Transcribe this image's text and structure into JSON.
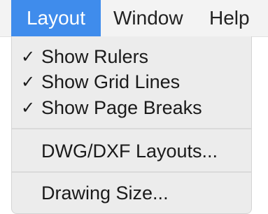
{
  "menubar": {
    "items": [
      {
        "label": "Layout",
        "active": true
      },
      {
        "label": "Window",
        "active": false
      },
      {
        "label": "Help",
        "active": false
      }
    ],
    "accent_color": "#3f8cec"
  },
  "dropdown": {
    "items": [
      {
        "label": "Show Rulers",
        "checked": true,
        "check": "✓",
        "icon": "checkmark-icon"
      },
      {
        "label": "Show Grid Lines",
        "checked": true,
        "check": "✓",
        "icon": "checkmark-icon"
      },
      {
        "label": "Show Page Breaks",
        "checked": true,
        "check": "✓",
        "icon": "checkmark-icon"
      },
      {
        "label": "DWG/DXF Layouts...",
        "checked": false
      },
      {
        "label": "Drawing Size...",
        "checked": false
      }
    ]
  }
}
